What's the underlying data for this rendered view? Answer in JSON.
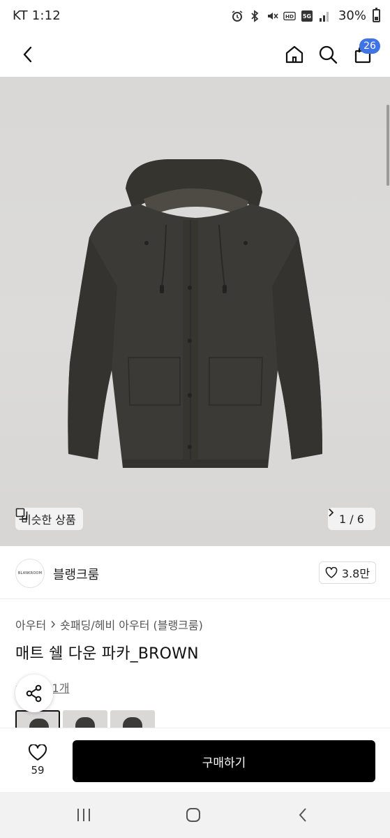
{
  "status_bar": {
    "carrier_time": "KT 1:12",
    "battery": "30%",
    "icons": [
      "alarm-icon",
      "bluetooth-icon",
      "mute-icon",
      "hd-icon",
      "5g-icon",
      "signal-icon",
      "battery-icon"
    ]
  },
  "header": {
    "icons": [
      "back-icon",
      "home-icon",
      "search-icon",
      "shopping-bag-icon"
    ],
    "cart_count": "26"
  },
  "gallery": {
    "similar_label": "비슷한 상품",
    "page_indicator": "1 / 6",
    "current_page": 1,
    "total_pages": 6
  },
  "shop": {
    "logo_text": "BLANKROOM",
    "name": "블랭크룸",
    "likes": "3.8만"
  },
  "product": {
    "breadcrumb": [
      "아우터",
      "숏패딩/헤비 아우터 (블랭크룸)"
    ],
    "title": "매트 쉘 다운 파카_BROWN",
    "review_text": "후기 1개"
  },
  "action_bar": {
    "wish_count": "59",
    "buy_label": "구매하기"
  },
  "colors": {
    "accent_badge": "#3f74e6",
    "buy_button": "#000000",
    "jacket": "#3b3a36"
  }
}
